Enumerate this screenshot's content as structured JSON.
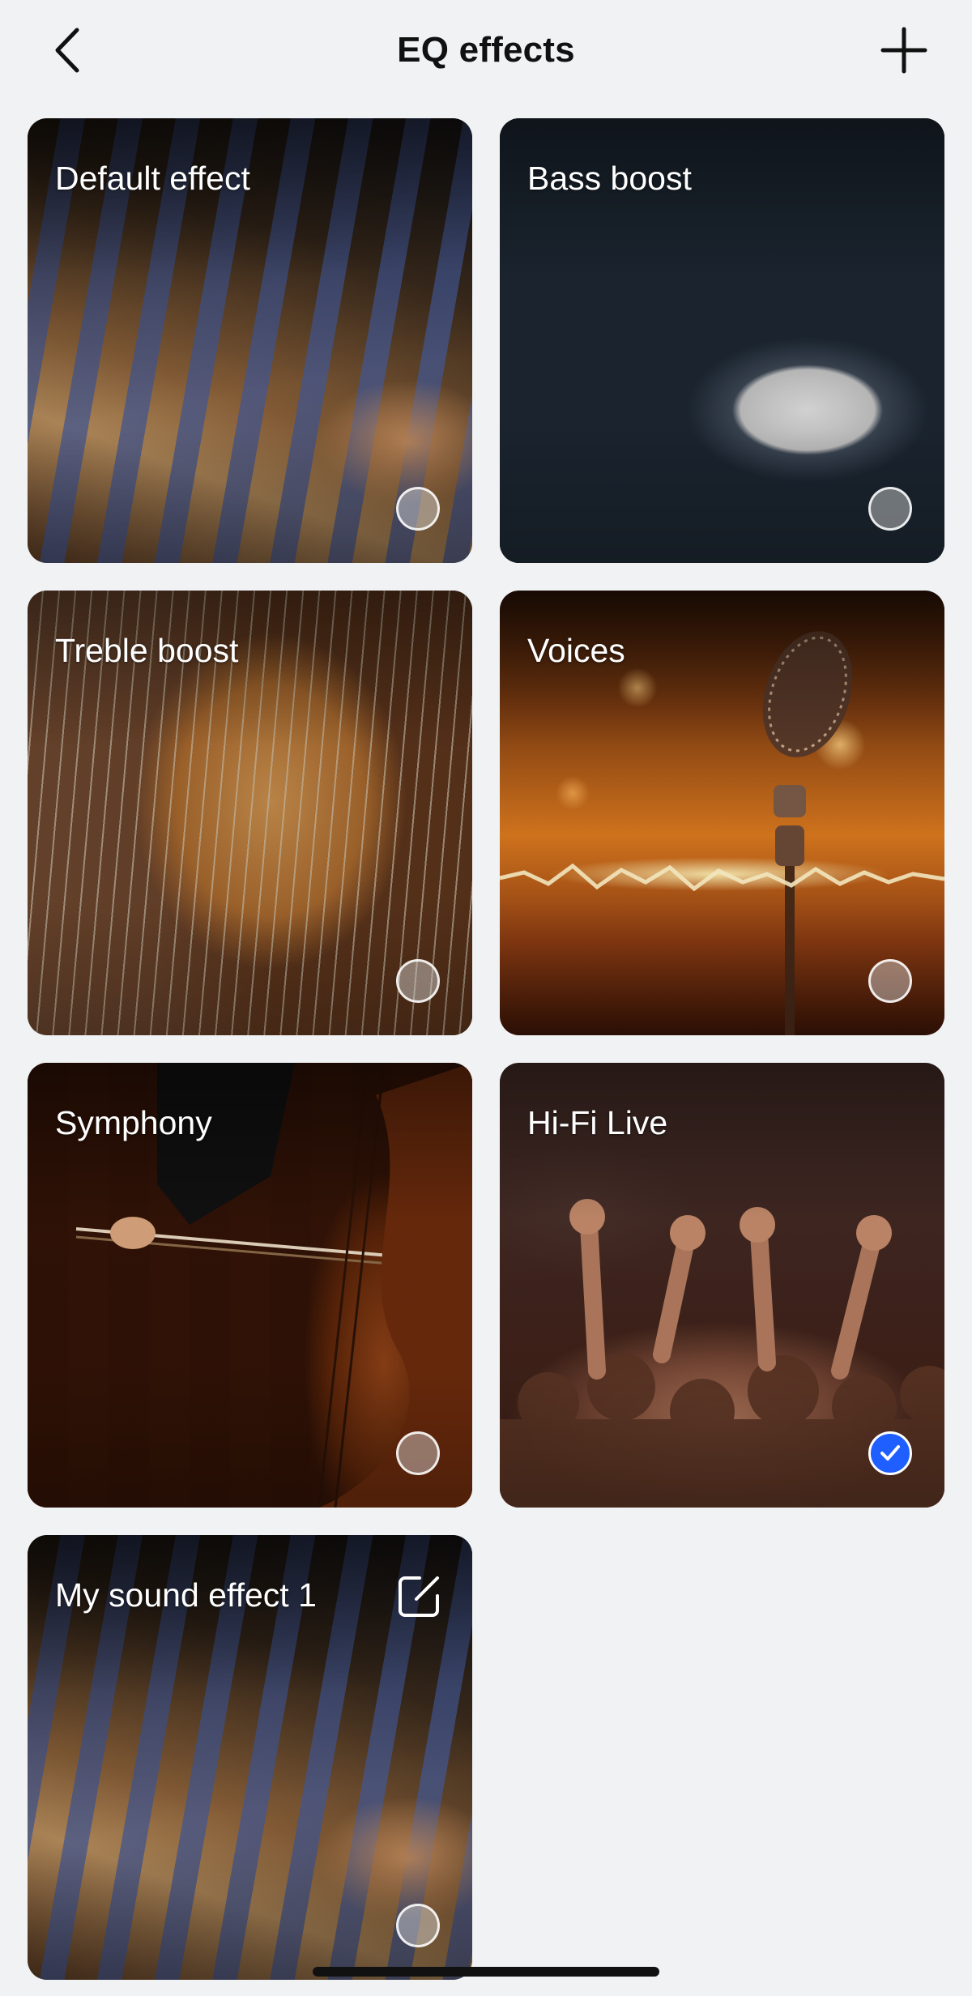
{
  "header": {
    "title": "EQ effects",
    "back_icon": "chevron-left-icon",
    "add_icon": "plus-icon"
  },
  "effects": [
    {
      "label": "Default effect",
      "selected": false,
      "editable": false
    },
    {
      "label": "Bass boost",
      "selected": false,
      "editable": false
    },
    {
      "label": "Treble boost",
      "selected": false,
      "editable": false
    },
    {
      "label": "Voices",
      "selected": false,
      "editable": false
    },
    {
      "label": "Symphony",
      "selected": false,
      "editable": false
    },
    {
      "label": "Hi-Fi Live",
      "selected": true,
      "editable": false
    },
    {
      "label": "My sound effect 1",
      "selected": false,
      "editable": true
    }
  ],
  "colors": {
    "background": "#f1f2f4",
    "accent": "#1f5fff",
    "title": "#111111"
  }
}
